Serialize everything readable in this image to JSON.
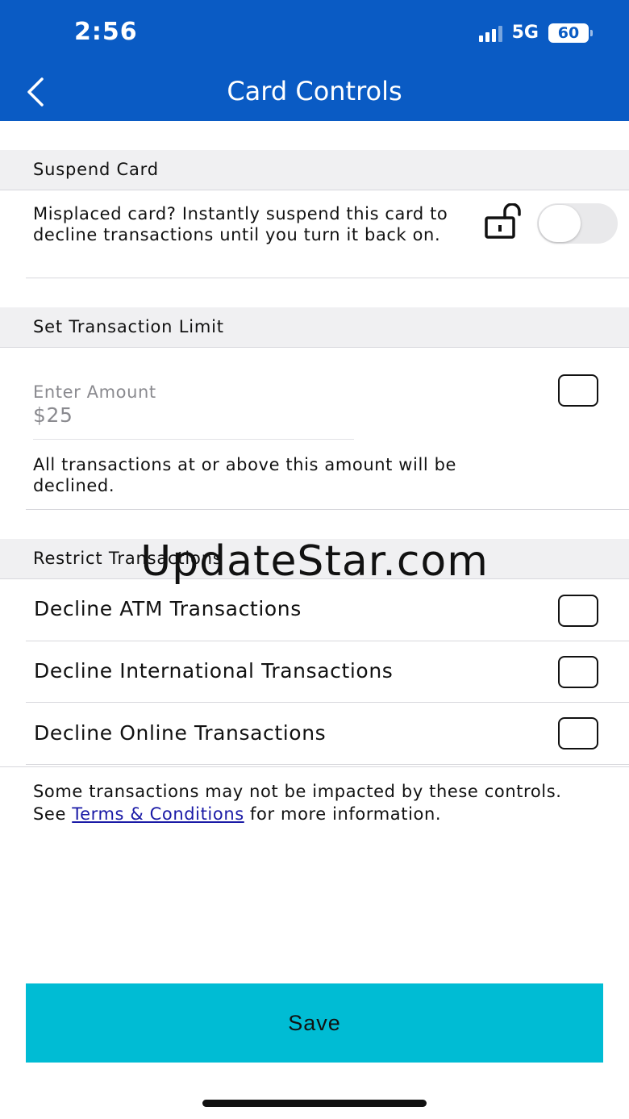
{
  "status_bar": {
    "time": "2:56",
    "network": "5G",
    "battery": "60"
  },
  "header": {
    "title": "Card Controls"
  },
  "suspend": {
    "heading": "Suspend Card",
    "description": "Misplaced card? Instantly suspend this card to decline transactions until you turn it back on.",
    "enabled": false
  },
  "limit": {
    "heading": "Set Transaction Limit",
    "field_label": "Enter Amount",
    "amount": "$25",
    "note": "All transactions at or above this amount will be declined.",
    "checked": false
  },
  "restrict": {
    "heading": "Restrict Transactions",
    "items": [
      {
        "label": "Decline ATM Transactions",
        "checked": false
      },
      {
        "label": "Decline International Transactions",
        "checked": false
      },
      {
        "label": "Decline Online Transactions",
        "checked": false
      }
    ]
  },
  "footer_note": {
    "before": "Some transactions may not be impacted by these controls. See ",
    "link": "Terms & Conditions",
    "after": " for more information."
  },
  "save_label": "Save",
  "watermark": "UpdateStar.com",
  "colors": {
    "header": "#0a5bc4",
    "save_button": "#00bcd4",
    "link": "#1a1aa6"
  }
}
